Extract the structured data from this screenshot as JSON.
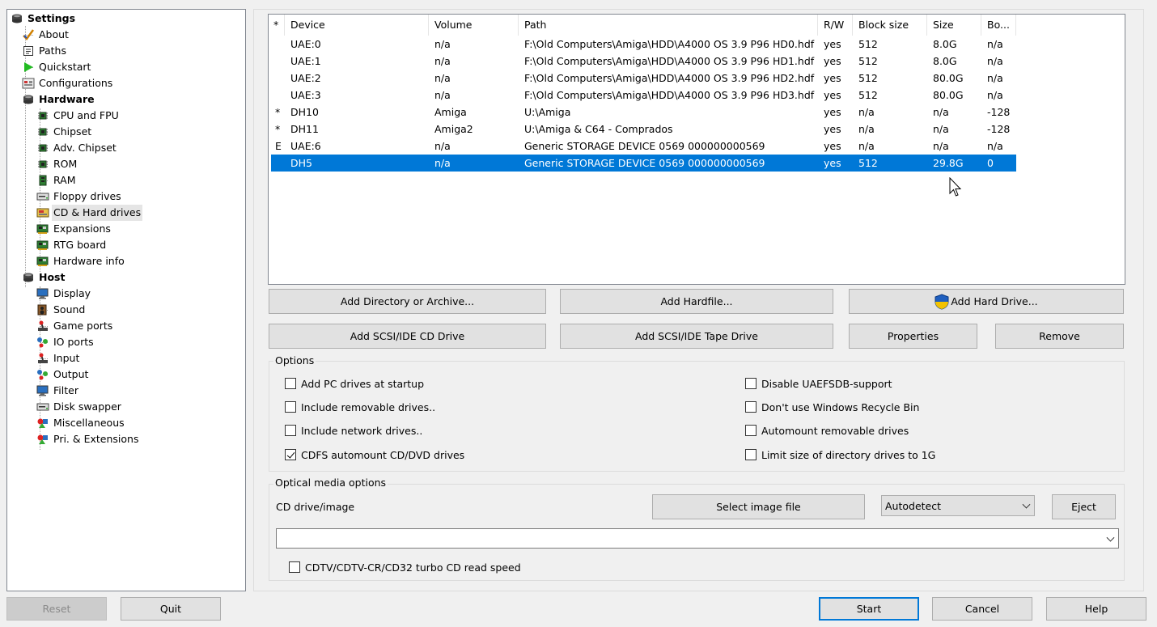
{
  "tree": {
    "root": "Settings",
    "items": [
      {
        "label": "About",
        "icon": "checkmark-icon"
      },
      {
        "label": "Paths",
        "icon": "document-icon"
      },
      {
        "label": "Quickstart",
        "icon": "play-icon"
      },
      {
        "label": "Configurations",
        "icon": "config-icon"
      }
    ],
    "hardware": {
      "label": "Hardware",
      "items": [
        {
          "label": "CPU and FPU",
          "icon": "chip-icon"
        },
        {
          "label": "Chipset",
          "icon": "chip-icon"
        },
        {
          "label": "Adv. Chipset",
          "icon": "chip-icon"
        },
        {
          "label": "ROM",
          "icon": "chip-icon"
        },
        {
          "label": "RAM",
          "icon": "memory-icon"
        },
        {
          "label": "Floppy drives",
          "icon": "floppy-drive-icon"
        },
        {
          "label": "CD & Hard drives",
          "icon": "harddrive-icon"
        },
        {
          "label": "Expansions",
          "icon": "expansion-card-icon"
        },
        {
          "label": "RTG board",
          "icon": "expansion-card-icon"
        },
        {
          "label": "Hardware info",
          "icon": "expansion-card-icon"
        }
      ]
    },
    "host": {
      "label": "Host",
      "items": [
        {
          "label": "Display",
          "icon": "monitor-icon"
        },
        {
          "label": "Sound",
          "icon": "speaker-icon"
        },
        {
          "label": "Game ports",
          "icon": "joystick-icon"
        },
        {
          "label": "IO ports",
          "icon": "network-icon"
        },
        {
          "label": "Input",
          "icon": "joystick-icon"
        },
        {
          "label": "Output",
          "icon": "network-icon"
        },
        {
          "label": "Filter",
          "icon": "monitor-icon"
        },
        {
          "label": "Disk swapper",
          "icon": "floppy-drive-icon"
        },
        {
          "label": "Miscellaneous",
          "icon": "shapes-icon"
        },
        {
          "label": "Pri. & Extensions",
          "icon": "shapes-icon"
        }
      ]
    },
    "selected": "CD & Hard drives"
  },
  "drives_table": {
    "columns": [
      "*",
      "Device",
      "Volume",
      "Path",
      "R/W",
      "Block size",
      "Size",
      "Bo..."
    ],
    "rows": [
      [
        "",
        "UAE:0",
        "n/a",
        "F:\\Old Computers\\Amiga\\HDD\\A4000 OS 3.9 P96 HD0.hdf",
        "yes",
        "512",
        "8.0G",
        "n/a"
      ],
      [
        "",
        "UAE:1",
        "n/a",
        "F:\\Old Computers\\Amiga\\HDD\\A4000 OS 3.9 P96 HD1.hdf",
        "yes",
        "512",
        "8.0G",
        "n/a"
      ],
      [
        "",
        "UAE:2",
        "n/a",
        "F:\\Old Computers\\Amiga\\HDD\\A4000 OS 3.9 P96 HD2.hdf",
        "yes",
        "512",
        "80.0G",
        "n/a"
      ],
      [
        "",
        "UAE:3",
        "n/a",
        "F:\\Old Computers\\Amiga\\HDD\\A4000 OS 3.9 P96 HD3.hdf",
        "yes",
        "512",
        "80.0G",
        "n/a"
      ],
      [
        "*",
        "DH10",
        "Amiga",
        "U:\\Amiga",
        "yes",
        "n/a",
        "n/a",
        "-128"
      ],
      [
        "*",
        "DH11",
        "Amiga2",
        "U:\\Amiga & C64 - Comprados",
        "yes",
        "n/a",
        "n/a",
        "-128"
      ],
      [
        "E",
        "UAE:6",
        "n/a",
        "Generic STORAGE DEVICE 0569 000000000569",
        "yes",
        "n/a",
        "n/a",
        "n/a"
      ],
      [
        "",
        "DH5",
        "n/a",
        "Generic STORAGE DEVICE 0569 000000000569",
        "yes",
        "512",
        "29.8G",
        "0"
      ]
    ],
    "selected_row": 7
  },
  "buttons": {
    "add_directory": "Add Directory or Archive...",
    "add_hardfile": "Add Hardfile...",
    "add_hard_drive": "Add Hard Drive...",
    "add_cd_drive": "Add SCSI/IDE CD Drive",
    "add_tape_drive": "Add SCSI/IDE Tape Drive",
    "properties": "Properties",
    "remove": "Remove"
  },
  "options": {
    "title": "Options",
    "left": [
      {
        "label": "Add PC drives at startup",
        "checked": false
      },
      {
        "label": "Include removable drives..",
        "checked": false
      },
      {
        "label": "Include network drives..",
        "checked": false
      },
      {
        "label": "CDFS automount CD/DVD drives",
        "checked": true
      }
    ],
    "right": [
      {
        "label": "Disable UAEFSDB-support",
        "checked": false
      },
      {
        "label": "Don't use Windows Recycle Bin",
        "checked": false
      },
      {
        "label": "Automount removable drives",
        "checked": false
      },
      {
        "label": "Limit size of directory drives to 1G",
        "checked": false
      }
    ]
  },
  "optical": {
    "title": "Optical media options",
    "drive_label": "CD drive/image",
    "select_image": "Select image file",
    "mode_value": "Autodetect",
    "eject": "Eject",
    "image_path": "",
    "turbo_label": "CDTV/CDTV-CR/CD32 turbo CD read speed",
    "turbo_checked": false
  },
  "footer": {
    "reset": "Reset",
    "quit": "Quit",
    "start": "Start",
    "cancel": "Cancel",
    "help": "Help"
  },
  "colors": {
    "selection": "#0078d7",
    "window_bg": "#f0f0f0",
    "button_bg": "#e1e1e1"
  }
}
